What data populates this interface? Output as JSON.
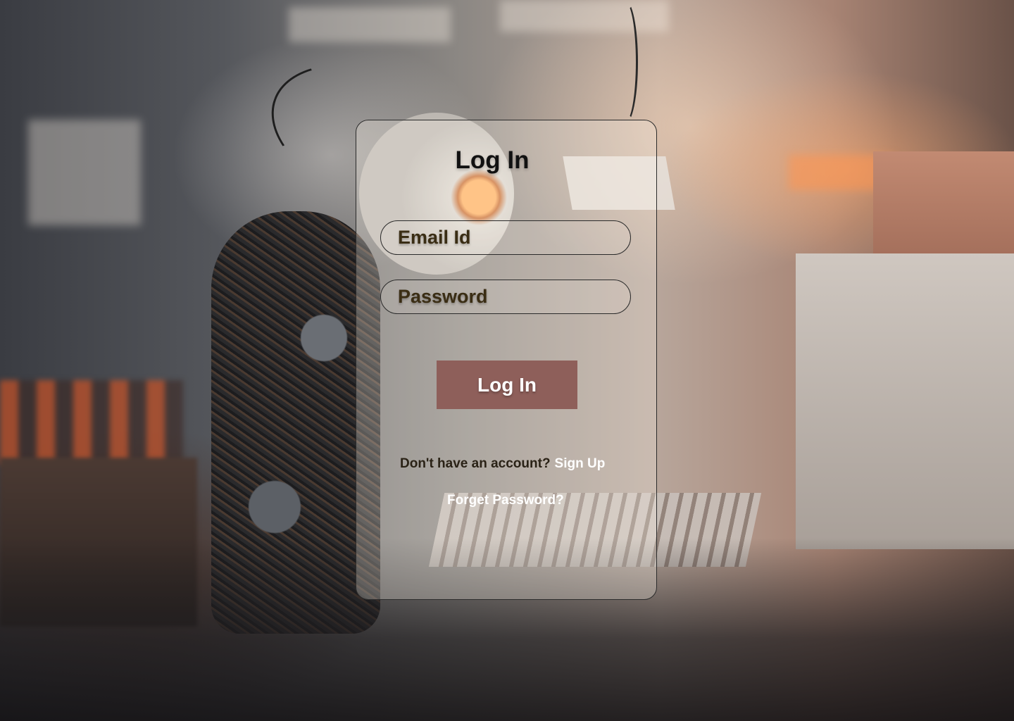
{
  "login": {
    "title": "Log In",
    "email_placeholder": "Email Id",
    "password_placeholder": "Password",
    "submit_label": "Log In",
    "no_account_text": "Don't have an account?",
    "signup_link": "Sign Up",
    "forgot_link": "Forget Password?"
  },
  "colors": {
    "button": "#8e5f5a",
    "link": "#ffffff",
    "text": "#111111"
  }
}
